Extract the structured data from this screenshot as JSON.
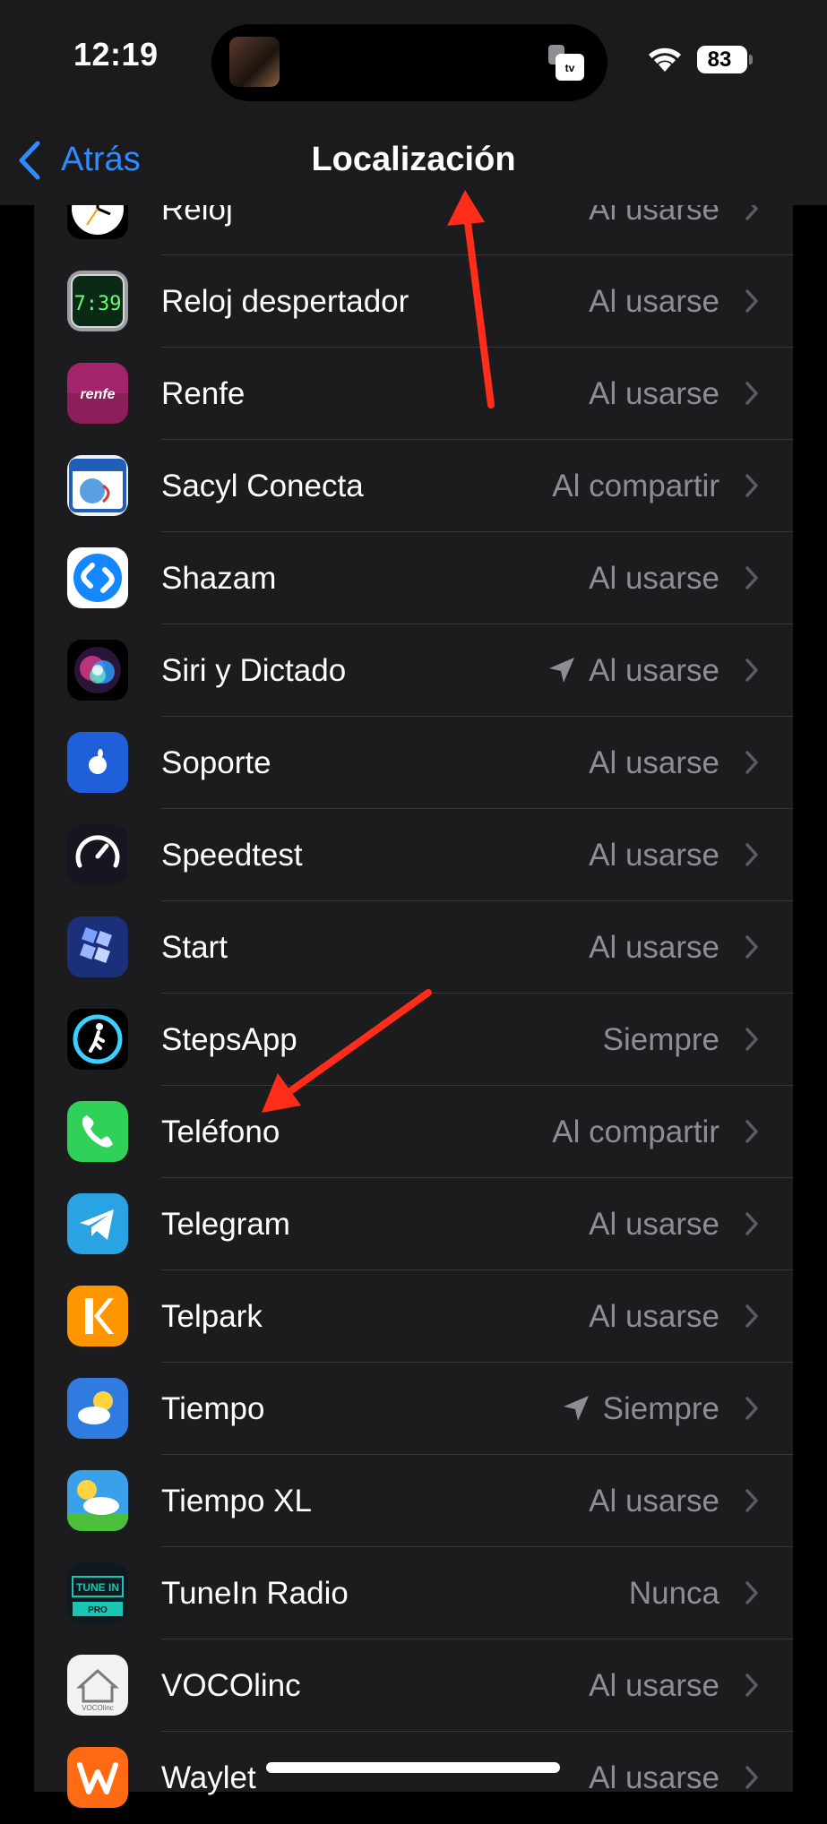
{
  "status_bar": {
    "time": "12:19",
    "battery": "83"
  },
  "nav": {
    "back_label": "Atrás",
    "title": "Localización"
  },
  "apps": [
    {
      "name": "Reloj",
      "value": "Al usarse",
      "icon": "clock-icon"
    },
    {
      "name": "Reloj despertador",
      "value": "Al usarse",
      "icon": "alarm-clock-icon",
      "icon_text": "7:39"
    },
    {
      "name": "Renfe",
      "value": "Al usarse",
      "icon": "renfe-icon",
      "icon_text": "renfe"
    },
    {
      "name": "Sacyl Conecta",
      "value": "Al compartir",
      "icon": "sacyl-calendar-icon"
    },
    {
      "name": "Shazam",
      "value": "Al usarse",
      "icon": "shazam-icon"
    },
    {
      "name": "Siri y Dictado",
      "value": "Al usarse",
      "icon": "siri-icon",
      "location_arrow": true
    },
    {
      "name": "Soporte",
      "value": "Al usarse",
      "icon": "apple-support-icon"
    },
    {
      "name": "Speedtest",
      "value": "Al usarse",
      "icon": "speedtest-icon"
    },
    {
      "name": "Start",
      "value": "Al usarse",
      "icon": "start-icon"
    },
    {
      "name": "StepsApp",
      "value": "Siempre",
      "icon": "stepsapp-icon"
    },
    {
      "name": "Teléfono",
      "value": "Al compartir",
      "icon": "phone-icon"
    },
    {
      "name": "Telegram",
      "value": "Al usarse",
      "icon": "telegram-icon"
    },
    {
      "name": "Telpark",
      "value": "Al usarse",
      "icon": "telpark-icon"
    },
    {
      "name": "Tiempo",
      "value": "Siempre",
      "icon": "weather-icon",
      "location_arrow": true
    },
    {
      "name": "Tiempo XL",
      "value": "Al usarse",
      "icon": "weather-xl-icon"
    },
    {
      "name": "TuneIn Radio",
      "value": "Nunca",
      "icon": "tunein-icon",
      "icon_text": "TUNE IN",
      "icon_text2": "PRO"
    },
    {
      "name": "VOCOlinc",
      "value": "Al usarse",
      "icon": "vocolinc-icon",
      "icon_text": "VOCOlinc"
    },
    {
      "name": "Waylet",
      "value": "Al usarse",
      "icon": "waylet-icon"
    }
  ],
  "colors": {
    "accent": "#2f8cff",
    "background": "#000000",
    "cell": "#1c1c1e",
    "secondary_text": "#8d8d93",
    "annotation_arrow": "#ff2d1a"
  }
}
